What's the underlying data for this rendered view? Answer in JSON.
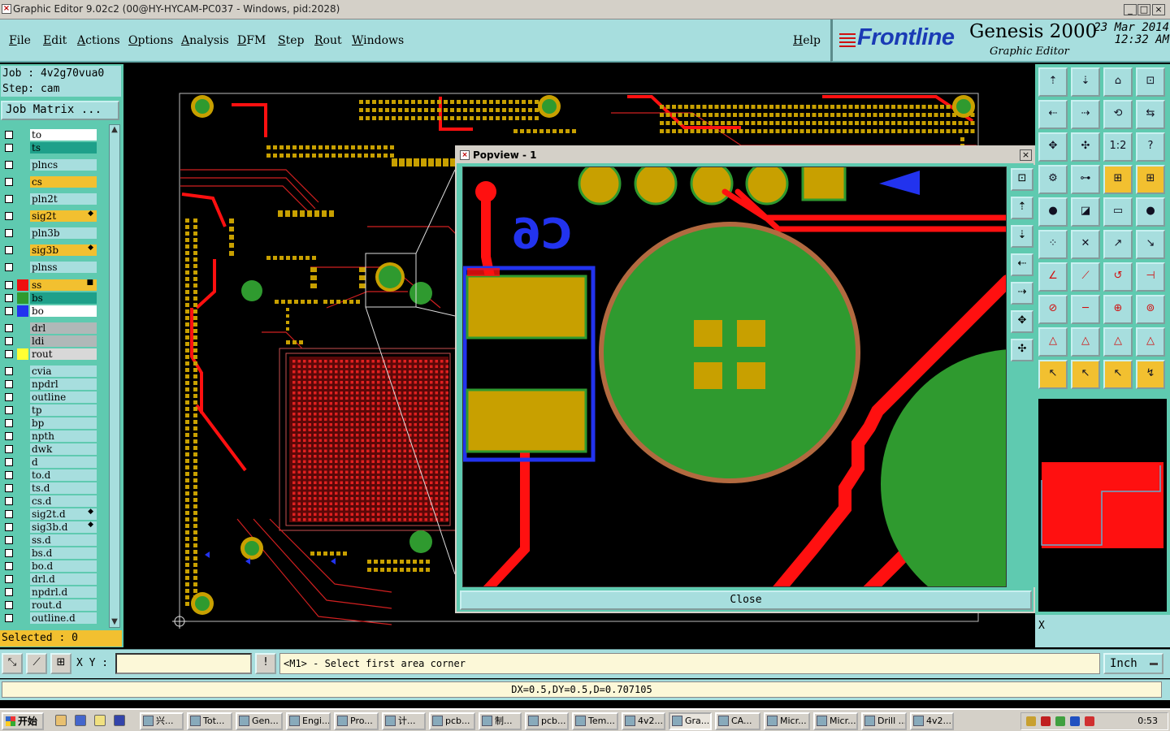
{
  "window": {
    "title": "Graphic Editor 9.02c2 (00@HY-HYCAM-PC037 - Windows, pid:2028)"
  },
  "menu": {
    "items": [
      "File",
      "Edit",
      "Actions",
      "Options",
      "Analysis",
      "DFM",
      "Step",
      "Rout",
      "Windows"
    ],
    "help": "Help"
  },
  "brand": {
    "logo": "Frontline",
    "product": "Genesis 2000",
    "subtitle": "Graphic Editor",
    "date": "23 Mar 2014",
    "time": "12:32 AM"
  },
  "job": {
    "job_line": "Job : 4v2g70vua0",
    "step_line": "Step: cam",
    "matrix_button": "Job Matrix ..."
  },
  "layers": [
    {
      "name": "to",
      "color": "#ffffff"
    },
    {
      "name": "ts",
      "color": "#1ea08a"
    },
    {
      "name": "plncs",
      "color": "#a7dede"
    },
    {
      "name": "cs",
      "color": "#f2c030"
    },
    {
      "name": "pln2t",
      "color": "#a7dede"
    },
    {
      "name": "sig2t",
      "color": "#f2c030",
      "mark": "◆"
    },
    {
      "name": "pln3b",
      "color": "#a7dede"
    },
    {
      "name": "sig3b",
      "color": "#f2c030",
      "mark": "◆"
    },
    {
      "name": "plnss",
      "color": "#a7dede"
    },
    {
      "name": "ss",
      "color": "#f2c030",
      "mark": "■",
      "swatch": "#ee1111",
      "active": true
    },
    {
      "name": "bs",
      "color": "#1ea08a",
      "swatch": "#2f9a2f"
    },
    {
      "name": "bo",
      "color": "#ffffff",
      "swatch": "#2233ee"
    },
    {
      "name": "drl",
      "color": "#b0b8b8"
    },
    {
      "name": "ldi",
      "color": "#b0b8b8"
    },
    {
      "name": "rout",
      "color": "#d8d8d8",
      "swatch": "#ffff33"
    },
    {
      "name": "cvia",
      "color": "#a7dede"
    },
    {
      "name": "npdrl",
      "color": "#a7dede"
    },
    {
      "name": "outline",
      "color": "#a7dede"
    },
    {
      "name": "tp",
      "color": "#a7dede"
    },
    {
      "name": "bp",
      "color": "#a7dede"
    },
    {
      "name": "npth",
      "color": "#a7dede"
    },
    {
      "name": "dwk",
      "color": "#a7dede"
    },
    {
      "name": "d",
      "color": "#a7dede"
    },
    {
      "name": "to.d",
      "color": "#a7dede"
    },
    {
      "name": "ts.d",
      "color": "#a7dede"
    },
    {
      "name": "cs.d",
      "color": "#a7dede"
    },
    {
      "name": "sig2t.d",
      "color": "#a7dede",
      "mark": "◆"
    },
    {
      "name": "sig3b.d",
      "color": "#a7dede",
      "mark": "◆"
    },
    {
      "name": "ss.d",
      "color": "#a7dede"
    },
    {
      "name": "bs.d",
      "color": "#a7dede"
    },
    {
      "name": "bo.d",
      "color": "#a7dede"
    },
    {
      "name": "drl.d",
      "color": "#a7dede"
    },
    {
      "name": "npdrl.d",
      "color": "#a7dede"
    },
    {
      "name": "rout.d",
      "color": "#a7dede"
    },
    {
      "name": "outline.d",
      "color": "#a7dede"
    }
  ],
  "selected": "Selected : 0",
  "popview": {
    "title": "Popview - 1",
    "component_label": "C6",
    "close_button": "Close"
  },
  "right_panel": {
    "x_label": "X"
  },
  "command": {
    "xy_label": "X Y :",
    "xy_value": "",
    "prompt": "<M1> - Select first area corner",
    "unit": "Inch"
  },
  "status": {
    "measure": "DX=0.5,DY=0.5,D=0.707105"
  },
  "taskbar": {
    "start": "开始",
    "tasks": [
      "兴...",
      "Tot...",
      "Gen...",
      "Engi...",
      "Pro...",
      "计...",
      "pcb...",
      "制...",
      "pcb...",
      "Tem...",
      "4v2...",
      "Gra...",
      "CA...",
      "Micr...",
      "Micr...",
      "Drill ...",
      "4v2..."
    ],
    "active_task": "Gra...",
    "clock": "0:53"
  },
  "colors": {
    "panel_bg": "#5fcab0",
    "field_bg": "#a7dede",
    "copper_signal": "#ff1010",
    "copper_pad": "#c8a000",
    "solder_mask": "#2f9a2f",
    "silkscreen": "#2233ee"
  }
}
